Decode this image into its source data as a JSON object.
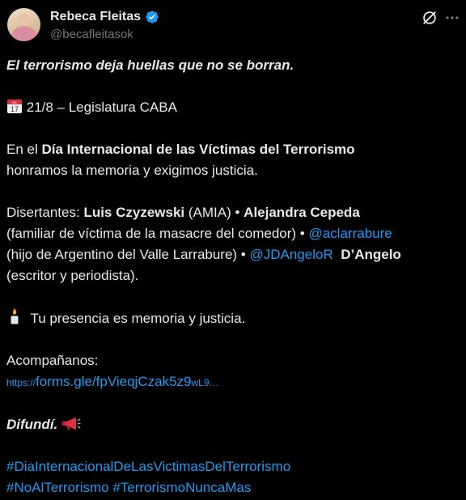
{
  "author": {
    "name": "Rebeca Fleitas",
    "handle": "@becafleitasok"
  },
  "post": {
    "headline": "El terrorismo deja huellas que no se borran.",
    "event_line": "21/8 – Legislatura CABA",
    "calendar_day": "17",
    "calendar_month": "JUL",
    "intro_prefix": "En el ",
    "intro_bold": "Día Internacional de las Víctimas del Terrorismo",
    "intro_suffix": "honramos la memoria y exigimos justicia.",
    "speakers_prefix": "Disertantes: ",
    "speaker1": "Luis Czyzewski",
    "speaker1_org": " (AMIA) • ",
    "speaker2": "Alejandra Cepeda",
    "speaker2_desc": "(familiar de víctima de la masacre del comedor) • ",
    "mention1": "@aclarrabure",
    "mention1_desc": "(hijo de Argentino del Valle Larrabure) • ",
    "mention2": "@JDAngeloR",
    "speaker3": "D’Angelo",
    "speaker3_desc": "(escritor y periodista).",
    "presence": "Tu presencia es memoria y justicia.",
    "join_label": "Acompañanos:",
    "link_prefix": "https://",
    "link_main": "forms.gle/fpVieqjCzak5z9",
    "link_suffix": "wL9…",
    "closing": "Difundí.",
    "hashtag1": "#DiaInternacionalDeLasVictimasDelTerrorismo",
    "hashtag2": "#NoAlTerrorismo",
    "hashtag3": "#TerrorismoNuncaMas"
  },
  "colors": {
    "background": "#000000",
    "text": "#e7e9ea",
    "secondary": "#71767b",
    "link": "#1d9bf0",
    "verified": "#1d9bf0"
  },
  "icons": [
    "verified-badge-icon",
    "grok-icon",
    "more-options-icon",
    "calendar-icon",
    "candle-icon",
    "megaphone-icon"
  ]
}
